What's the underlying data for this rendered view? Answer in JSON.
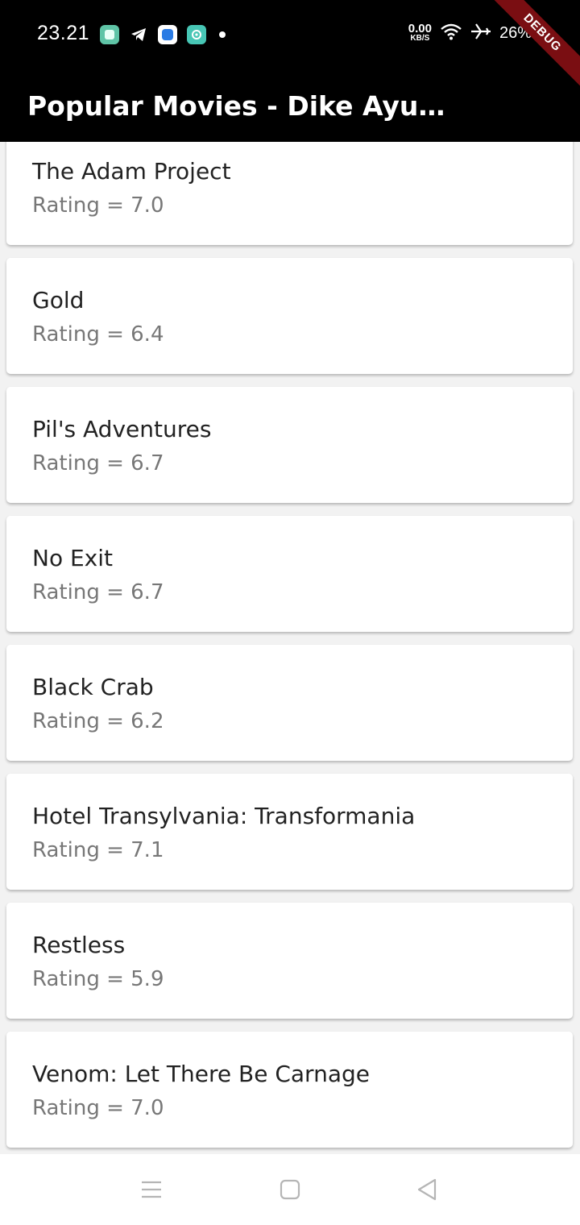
{
  "status_bar": {
    "time": "23.21",
    "net_speed_value": "0.00",
    "net_speed_unit": "KB/S",
    "battery": "26%",
    "debug_label": "DEBUG"
  },
  "app_bar": {
    "title": "Popular Movies - Dike Ayu …"
  },
  "movies": [
    {
      "title": "The Adam Project",
      "rating": "Rating = 7.0"
    },
    {
      "title": "Gold",
      "rating": "Rating = 6.4"
    },
    {
      "title": "Pil's Adventures",
      "rating": "Rating = 6.7"
    },
    {
      "title": "No Exit",
      "rating": "Rating = 6.7"
    },
    {
      "title": "Black Crab",
      "rating": "Rating = 6.2"
    },
    {
      "title": "Hotel Transylvania: Transformania",
      "rating": "Rating = 7.1"
    },
    {
      "title": "Restless",
      "rating": "Rating = 5.9"
    },
    {
      "title": "Venom: Let There Be Carnage",
      "rating": "Rating = 7.0"
    }
  ],
  "icons": {
    "notification_apps": [
      "green-app-icon",
      "telegram-icon",
      "blue-app-icon",
      "teal-app-icon"
    ],
    "status": [
      "wifi-icon",
      "airplane-icon"
    ],
    "nav": [
      "menu-icon",
      "home-icon",
      "back-icon"
    ]
  },
  "colors": {
    "app_bar": "#000000",
    "background": "#f2f2f2",
    "card": "#ffffff",
    "title_text": "#222222",
    "rating_text": "#777777",
    "debug_banner": "#7a0e12"
  }
}
